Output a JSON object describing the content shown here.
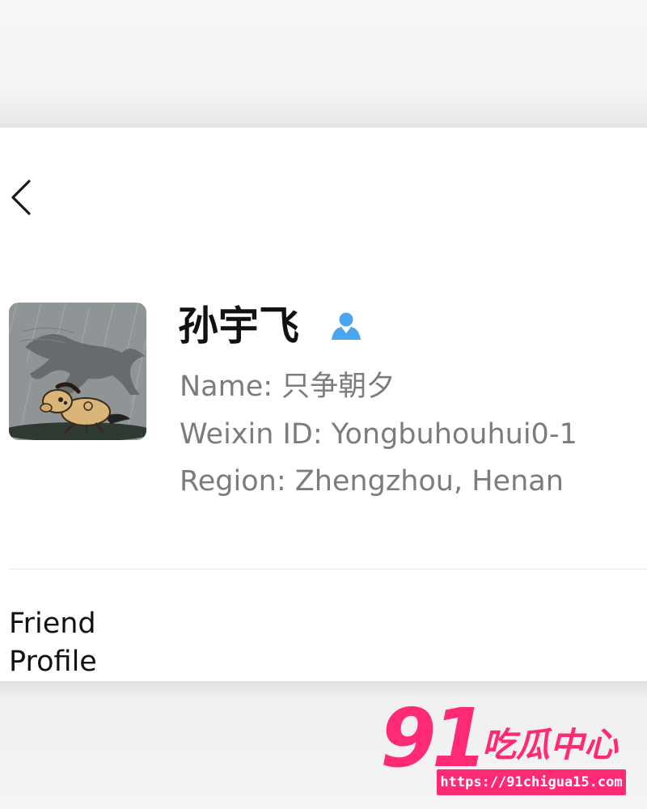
{
  "profile": {
    "display_name": "孙宇飞",
    "name_line": "Name: 只争朝夕",
    "weixin_id_line": "Weixin ID: Yongbuhouhui0-1",
    "region_line": "Region: Zhengzhou, Henan",
    "section_heading": "Friend Profile"
  },
  "icons": {
    "back": "chevron-left-icon",
    "contact": "contact-person-icon"
  },
  "colors": {
    "contact_icon": "#4aa6ee",
    "watermark": "#ff2a75",
    "secondary_text": "#7c7c7c"
  },
  "watermark": {
    "number": "91",
    "tagline": "吃瓜中心",
    "url": "https://91chigua15.com"
  }
}
